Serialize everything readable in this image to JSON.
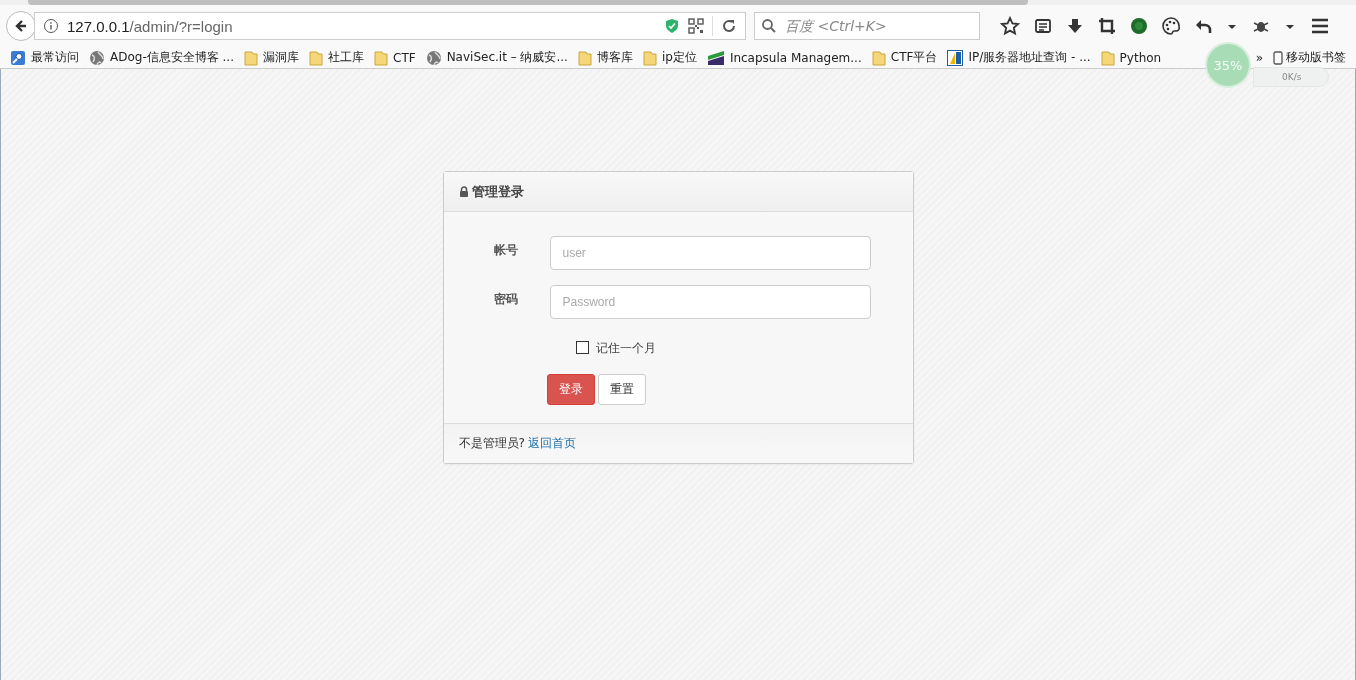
{
  "browser": {
    "url_host": "127.0.0.1",
    "url_path": "/admin/?r=login",
    "search": {
      "placeholder": "百度 <Ctrl+K>"
    }
  },
  "bookmarks": [
    {
      "label": "最常访问",
      "kind": "search"
    },
    {
      "label": "ADog-信息安全博客 ...",
      "kind": "globe"
    },
    {
      "label": "漏洞库",
      "kind": "folder"
    },
    {
      "label": "社工库",
      "kind": "folder"
    },
    {
      "label": "CTF",
      "kind": "folder"
    },
    {
      "label": "NaviSec.it – 纳威安...",
      "kind": "globe"
    },
    {
      "label": "博客库",
      "kind": "folder"
    },
    {
      "label": "ip定位",
      "kind": "folder"
    },
    {
      "label": "Incapsula Managem...",
      "kind": "stripes"
    },
    {
      "label": "CTF平台",
      "kind": "folder"
    },
    {
      "label": "IP/服务器地址查询 - ...",
      "kind": "tile"
    },
    {
      "label": "Python",
      "kind": "folder"
    }
  ],
  "more_bookmarks": "»",
  "mobile_bookmarks": "移动版书签",
  "speed_widget": {
    "percent": "35%",
    "rate": "0K/s"
  },
  "login_panel": {
    "title": "管理登录",
    "fields": [
      {
        "label": "帐号",
        "placeholder": "user"
      },
      {
        "label": "密码",
        "placeholder": "Password"
      }
    ],
    "remember": {
      "label": "记住一个月",
      "checked": false
    },
    "buttons": [
      {
        "label": "登录",
        "kind": "primary"
      },
      {
        "label": "重置",
        "kind": "default"
      }
    ],
    "footer": {
      "text": "不是管理员?",
      "link": "返回首页"
    }
  }
}
